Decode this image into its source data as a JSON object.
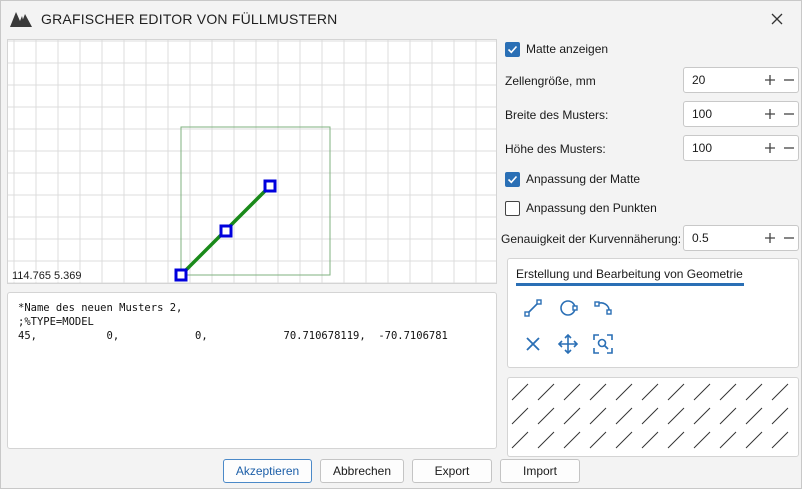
{
  "window": {
    "title": "GRAFISCHER EDITOR VON FÜLLMUSTERN"
  },
  "canvas": {
    "coords": "114.765 5.369"
  },
  "code": {
    "lines": [
      "*Name des neuen Musters 2,",
      ";%TYPE=MODEL",
      "45,           0,            0,            70.710678119,  -70.7106781"
    ]
  },
  "options": {
    "show_mat": {
      "label": "Matte anzeigen",
      "checked": true
    },
    "cell_size": {
      "label": "Zellengröße, mm",
      "value": "20"
    },
    "pattern_width": {
      "label": "Breite des Musters:",
      "value": "100"
    },
    "pattern_height": {
      "label": "Höhe des Musters:",
      "value": "100"
    },
    "snap_mat": {
      "label": "Anpassung der Matte",
      "checked": true
    },
    "snap_points": {
      "label": "Anpassung den Punkten",
      "checked": false
    },
    "curve_precision": {
      "label": "Genauigkeit der Kurvennäherung:",
      "value": "0.5"
    }
  },
  "geometry": {
    "title": "Erstellung und Bearbeitung von Geometrie",
    "tools": [
      "line-tool-icon",
      "circle-tool-icon",
      "arc-tool-icon",
      "delete-icon",
      "move-icon",
      "zoom-fit-icon"
    ]
  },
  "footer": {
    "accept": "Akzeptieren",
    "cancel": "Abbrechen",
    "export": "Export",
    "import": "Import"
  },
  "colors": {
    "accent": "#2a6fb5",
    "segment": "#1a8a1a",
    "boundary": "#7fb27f",
    "point": "#0000dd"
  }
}
